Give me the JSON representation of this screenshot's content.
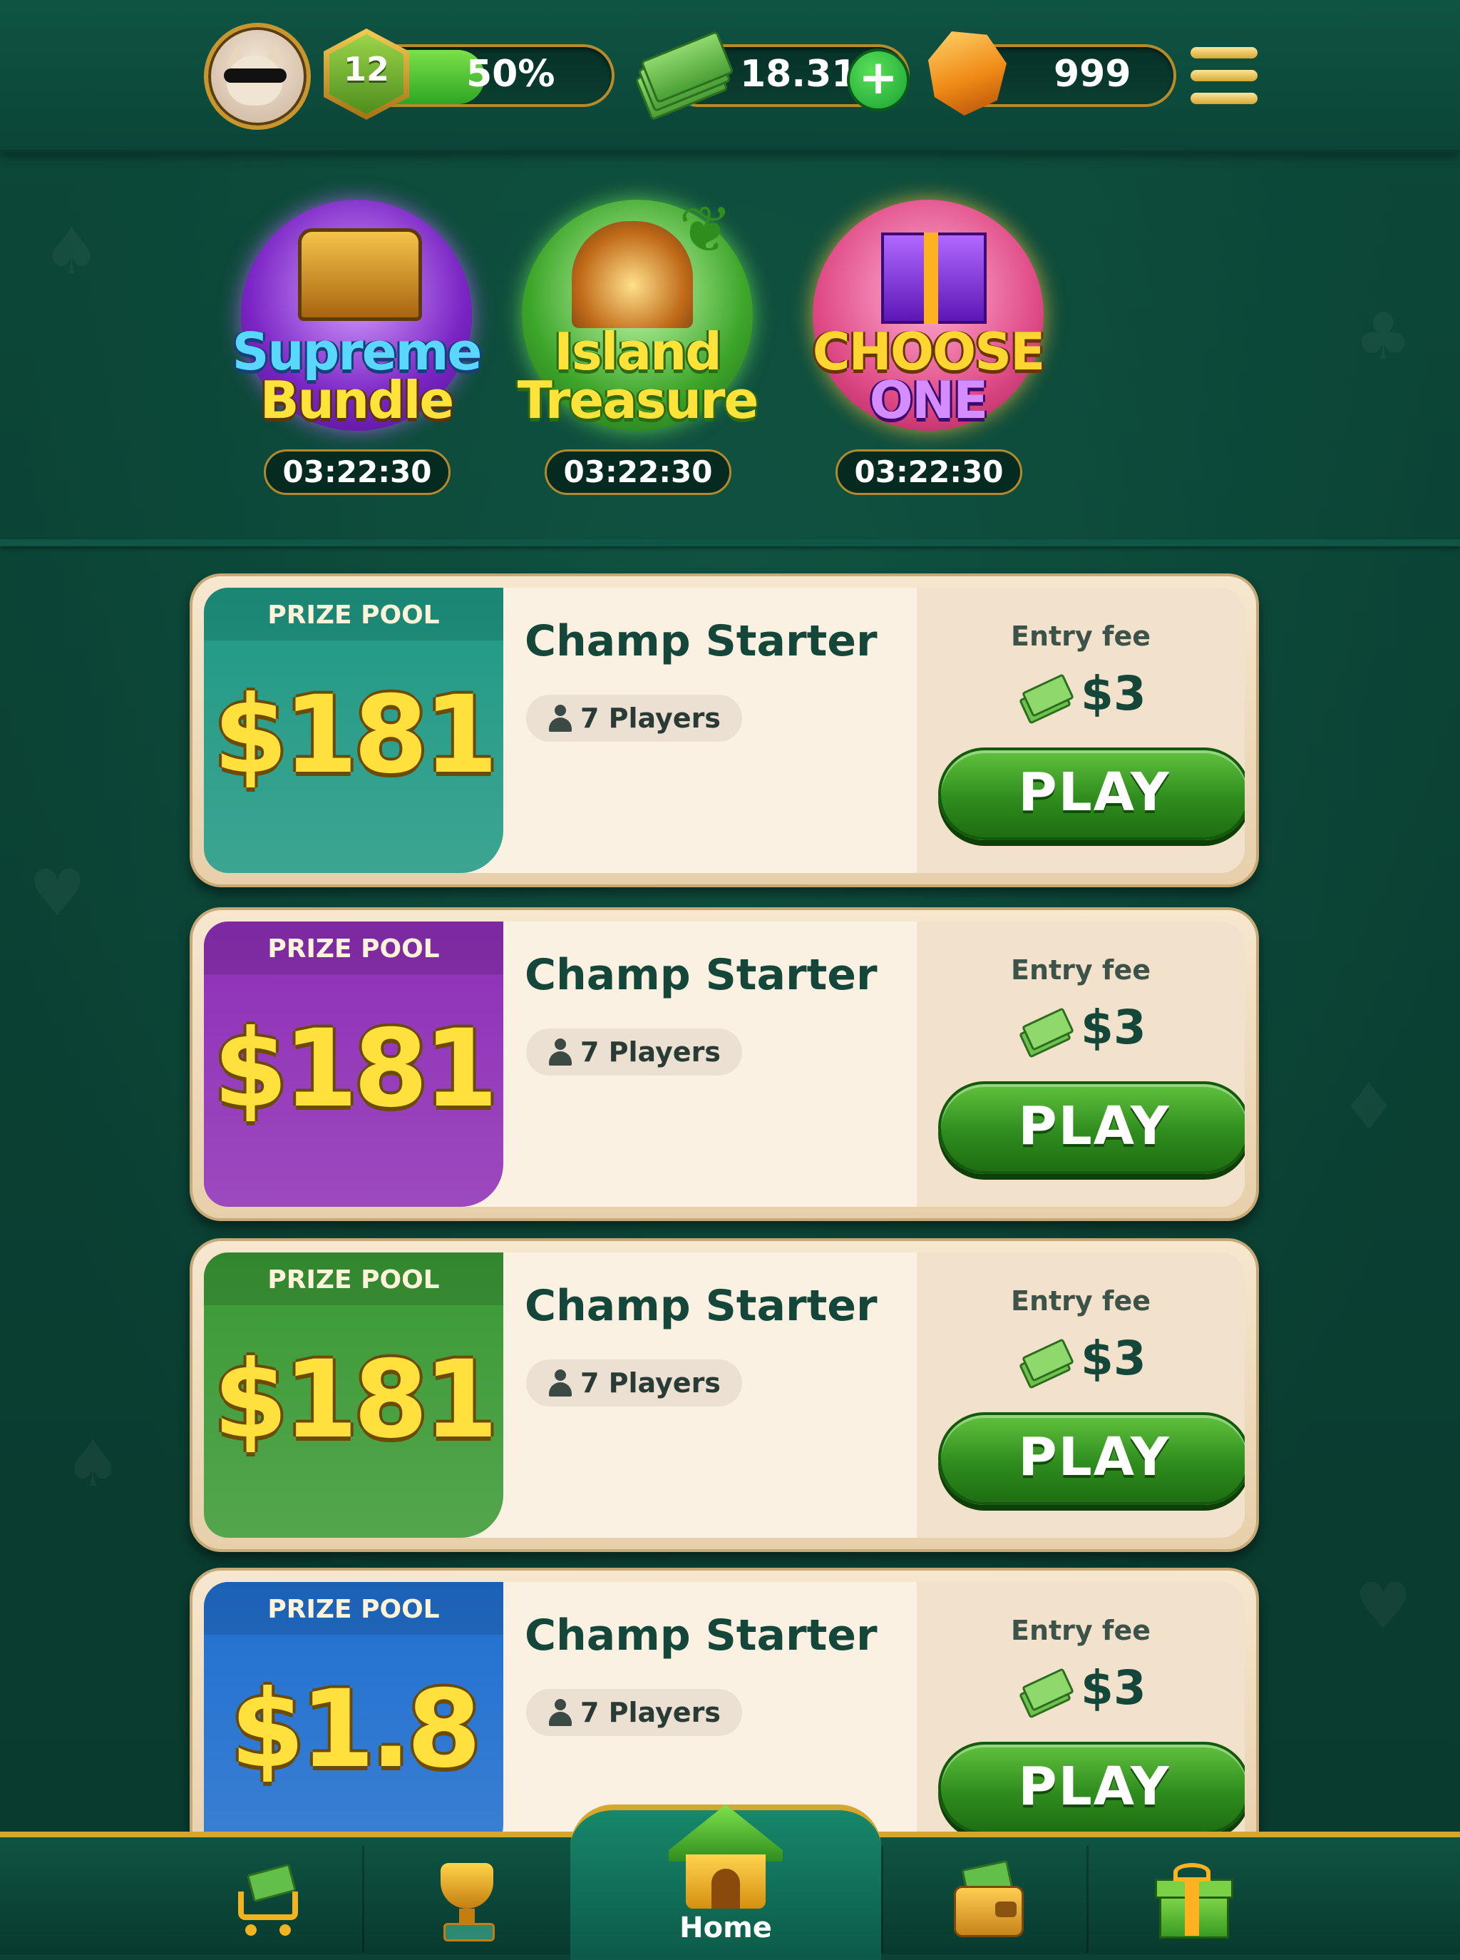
{
  "header": {
    "level": "12",
    "xp_percent_label": "50%",
    "xp_fraction": 0.5,
    "cash": "18.31",
    "gems": "999",
    "add_cash_symbol": "+"
  },
  "offers": [
    {
      "title_line1": "Supreme",
      "title_line2": "Bundle",
      "timer": "03:22:30",
      "icon": "treasure-chest-icon"
    },
    {
      "title_line1": "Island",
      "title_line2": "Treasure",
      "timer": "03:22:30",
      "icon": "treasure-cave-icon"
    },
    {
      "title_line1": "CHOOSE",
      "title_line2": "ONE",
      "timer": "03:22:30",
      "icon": "gift-box-icon"
    }
  ],
  "tournaments": [
    {
      "prize_label": "PRIZE POOL",
      "prize": "$181",
      "title": "Champ Starter",
      "players": "7 Players",
      "entry_label": "Entry fee",
      "fee": "$3",
      "play": "PLAY",
      "color": "#1f9985"
    },
    {
      "prize_label": "PRIZE POOL",
      "prize": "$181",
      "title": "Champ Starter",
      "players": "7 Players",
      "entry_label": "Entry fee",
      "fee": "$3",
      "play": "PLAY",
      "color": "#8e2fb8"
    },
    {
      "prize_label": "PRIZE POOL",
      "prize": "$181",
      "title": "Champ Starter",
      "players": "7 Players",
      "entry_label": "Entry fee",
      "fee": "$3",
      "play": "PLAY",
      "color": "#3a9a35"
    },
    {
      "prize_label": "PRIZE POOL",
      "prize": "$1.8",
      "title": "Champ Starter",
      "players": "7 Players",
      "entry_label": "Entry fee",
      "fee": "$3",
      "play": "PLAY",
      "color": "#1f6fd0"
    }
  ],
  "nav": {
    "home_label": "Home",
    "items": [
      "shop-cart-icon",
      "trophy-icon",
      "home-icon",
      "wallet-icon",
      "gift-icon"
    ]
  }
}
